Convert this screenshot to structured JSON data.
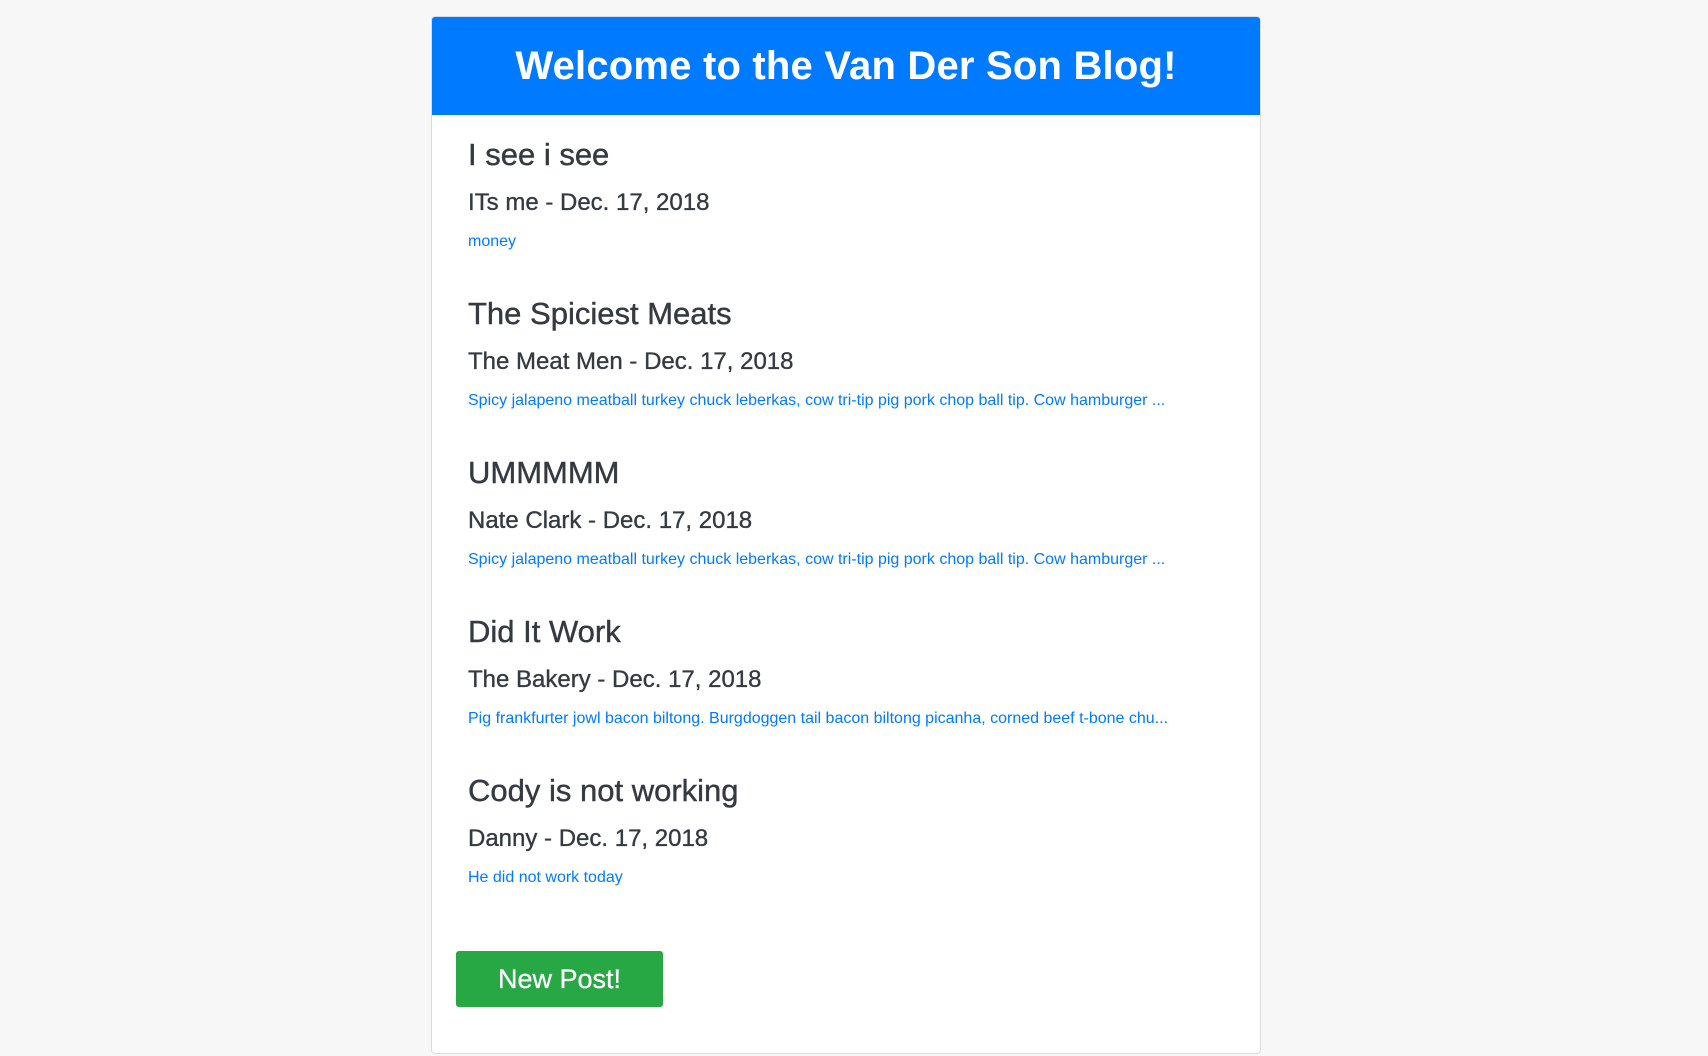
{
  "header": {
    "title": "Welcome to the Van Der Son Blog!"
  },
  "posts": [
    {
      "title": "I see i see",
      "meta": "ITs me - Dec. 17, 2018",
      "excerpt": "money"
    },
    {
      "title": "The Spiciest Meats",
      "meta": "The Meat Men - Dec. 17, 2018",
      "excerpt": "Spicy jalapeno meatball turkey chuck leberkas, cow tri-tip pig pork chop ball tip. Cow hamburger ..."
    },
    {
      "title": "UMMMMM",
      "meta": "Nate Clark - Dec. 17, 2018",
      "excerpt": "Spicy jalapeno meatball turkey chuck leberkas, cow tri-tip pig pork chop ball tip. Cow hamburger ..."
    },
    {
      "title": "Did It Work",
      "meta": "The Bakery - Dec. 17, 2018",
      "excerpt": "Pig frankfurter jowl bacon biltong. Burgdoggen tail bacon biltong picanha, corned beef t-bone chu..."
    },
    {
      "title": "Cody is not working",
      "meta": "Danny - Dec. 17, 2018",
      "excerpt": "He did not work today"
    }
  ],
  "actions": {
    "new_post_label": "New Post!"
  },
  "colors": {
    "header_bg": "#007bff",
    "link": "#007bff",
    "button_bg": "#28a745",
    "text": "#343a40"
  }
}
